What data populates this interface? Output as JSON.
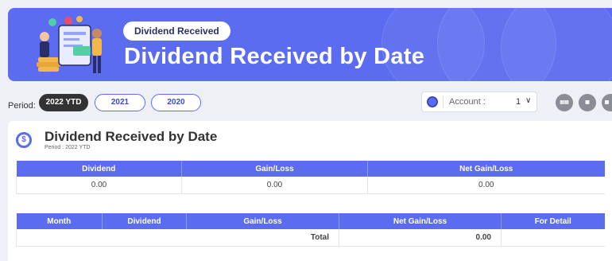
{
  "banner": {
    "pill_label": "Dividend Received",
    "title": "Dividend Received by Date"
  },
  "period": {
    "label": "Period:",
    "options": [
      "2022 YTD",
      "2021",
      "2020"
    ],
    "selected": "2022 YTD"
  },
  "account": {
    "label": "Account :",
    "value": "1"
  },
  "toolbar": {
    "icons": [
      "print-preview-icon",
      "pdf-icon",
      "print-icon"
    ]
  },
  "card": {
    "title": "Dividend Received by Date",
    "subtitle": "Period : 2022 YTD"
  },
  "summary_table": {
    "headers": [
      "Dividend",
      "Gain/Loss",
      "Net Gain/Loss"
    ],
    "row": [
      "0.00",
      "0.00",
      "0.00"
    ]
  },
  "detail_table": {
    "headers": [
      "Month",
      "Dividend",
      "Gain/Loss",
      "Net Gain/Loss",
      "For Detail"
    ],
    "total_label": "Total",
    "total_value": "0.00"
  },
  "colors": {
    "accent": "#5b6cf0",
    "dark": "#333333"
  }
}
